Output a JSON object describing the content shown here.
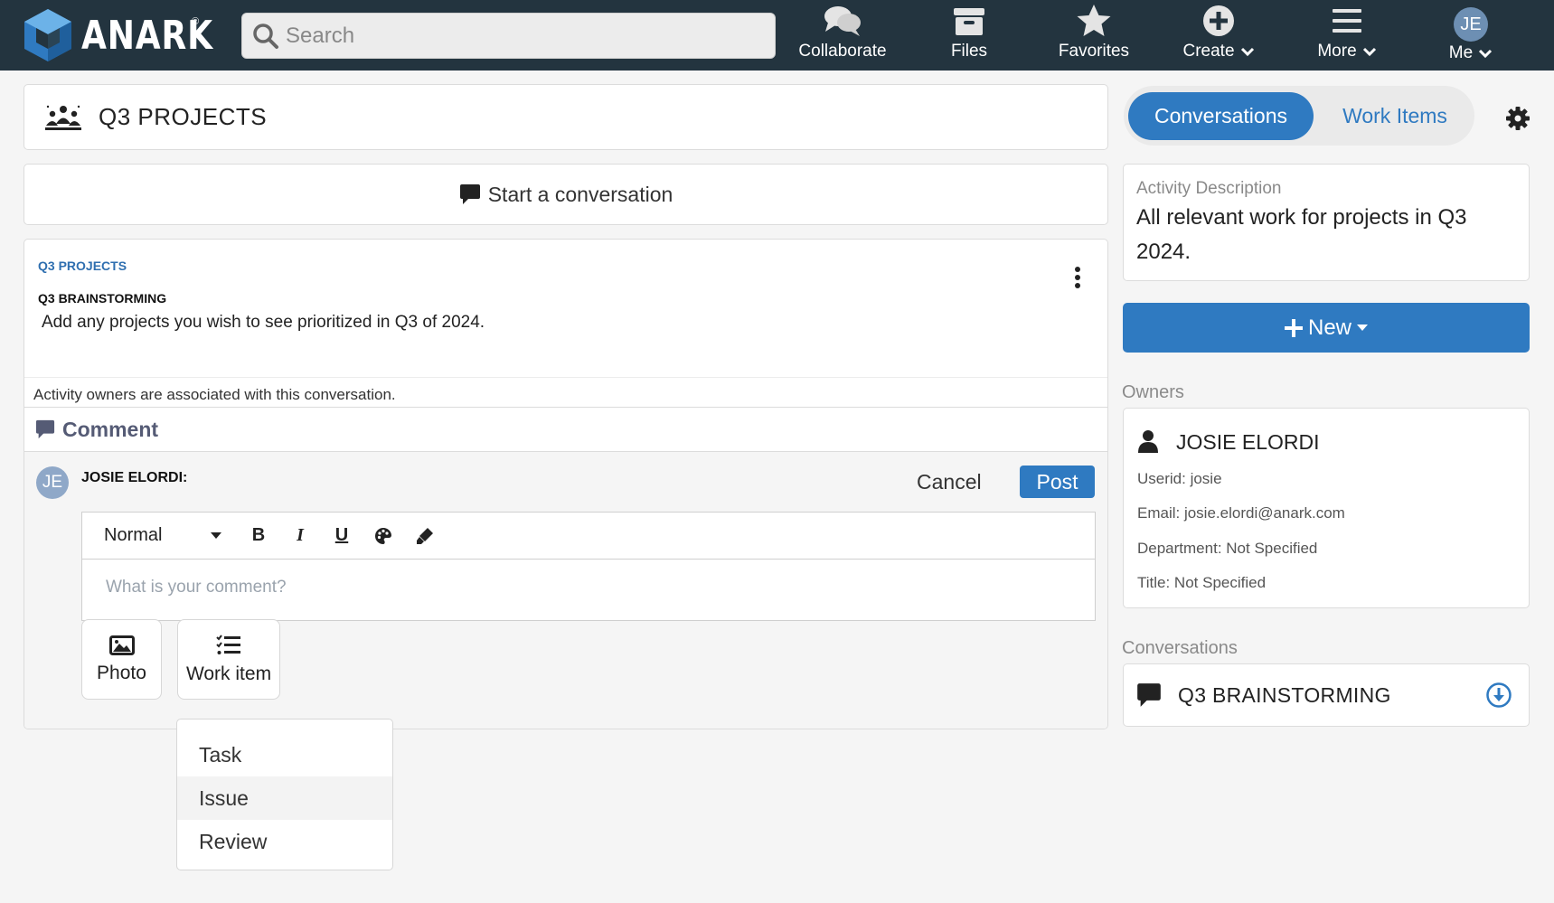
{
  "header": {
    "logo_text": "ANARK",
    "logo_reg": "®",
    "search_placeholder": "Search",
    "nav": {
      "collaborate": "Collaborate",
      "files": "Files",
      "favorites": "Favorites",
      "create": "Create",
      "more": "More",
      "me": "Me",
      "me_initials": "JE"
    }
  },
  "main": {
    "title": "Q3 PROJECTS",
    "start_conversation": "Start a conversation",
    "conversation": {
      "breadcrumb": "Q3 PROJECTS",
      "name": "Q3 BRAINSTORMING",
      "description": "Add any projects you wish to see prioritized in Q3 of 2024.",
      "owners_note": "Activity owners are associated with this conversation.",
      "comment_tab": "Comment"
    },
    "reply": {
      "avatar_initials": "JE",
      "author": "JOSIE ELORDI:",
      "cancel": "Cancel",
      "post": "Post",
      "format": "Normal",
      "bold": "B",
      "italic": "I",
      "underline": "U",
      "placeholder": "What is your comment?",
      "photo": "Photo",
      "work_item": "Work item"
    },
    "work_item_menu": [
      "Task",
      "Issue",
      "Review"
    ]
  },
  "sidebar": {
    "tab_conversations": "Conversations",
    "tab_work_items": "Work Items",
    "activity_label": "Activity Description",
    "activity_value": "All relevant work for projects in Q3 2024.",
    "new_button": "New",
    "owners_label": "Owners",
    "owner": {
      "name": "JOSIE ELORDI",
      "userid": "Userid: josie",
      "email": "Email: josie.elordi@anark.com",
      "department": "Department: Not Specified",
      "title": "Title: Not Specified"
    },
    "conversations_label": "Conversations",
    "conversation_item": "Q3 BRAINSTORMING"
  },
  "colors": {
    "topbar": "#23343f",
    "accent": "#2f7ac1",
    "comment_tab": "#555b75"
  }
}
